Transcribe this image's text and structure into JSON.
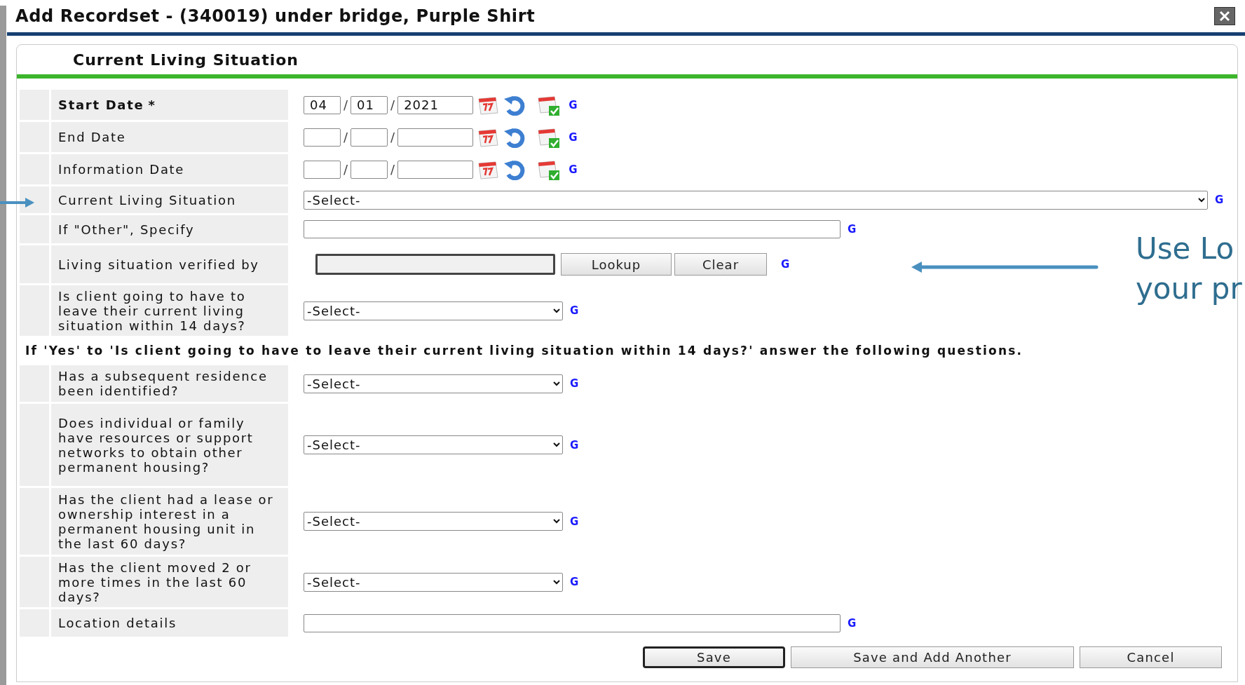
{
  "window": {
    "title": "Add Recordset - (340019) under bridge, Purple Shirt"
  },
  "section_title": "Current Living Situation",
  "fields": [
    {
      "kind": "date",
      "label": "Start Date",
      "required": true,
      "required_mark": "*",
      "month": "04",
      "day": "01",
      "year": "2021",
      "separators": [
        "/",
        "/"
      ],
      "link": "G"
    },
    {
      "kind": "date",
      "label": "End Date",
      "required": false,
      "separators": [
        "/",
        "/"
      ],
      "link": "G"
    },
    {
      "kind": "date",
      "label": "Information Date",
      "required": false,
      "separators": [
        "/",
        "/"
      ],
      "link": "G"
    },
    {
      "kind": "wideselect",
      "label": "Current Living Situation",
      "value": "-Select-",
      "link": "G"
    },
    {
      "kind": "text",
      "label": "If \"Other\", Specify",
      "link": "G"
    },
    {
      "kind": "lookup",
      "label": "Living situation verified by",
      "buttons": [
        "Lookup",
        "Clear"
      ],
      "link": "G"
    },
    {
      "kind": "select",
      "label": "Is client going to have to leave their current living situation within 14 days?",
      "value": "-Select-",
      "link": "G"
    },
    {
      "kind": "note",
      "text": "If 'Yes' to 'Is client going to have to leave their current living situation within 14 days?' answer the following questions."
    },
    {
      "kind": "select",
      "label": "Has a subsequent residence been identified?",
      "value": "-Select-",
      "link": "G"
    },
    {
      "kind": "select",
      "label": "Does individual or family have resources or support networks to obtain other permanent housing?",
      "value": "-Select-",
      "link": "G"
    },
    {
      "kind": "select",
      "label": "Has the client had a lease or ownership interest in a permanent housing unit in the last 60 days?",
      "value": "-Select-",
      "link": "G"
    },
    {
      "kind": "select",
      "label": "Has the client moved 2 or more times in the last 60 days?",
      "value": "-Select-",
      "link": "G"
    },
    {
      "kind": "text",
      "label": "Location details",
      "link": "G"
    }
  ],
  "buttons": [
    {
      "label": "Save",
      "default": true
    },
    {
      "label": "Save and Add Another",
      "default": false
    },
    {
      "label": "Cancel",
      "default": false
    }
  ],
  "annotation": {
    "lines": [
      "Use Lo",
      "your pr"
    ]
  }
}
